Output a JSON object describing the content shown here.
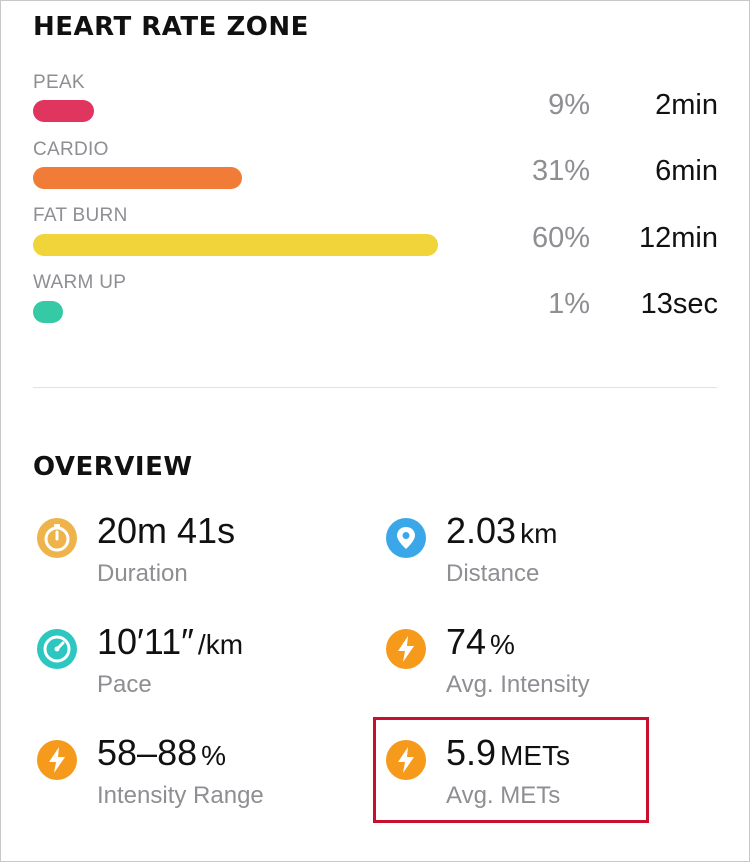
{
  "heart_rate_zone": {
    "title": "HEART RATE ZONE",
    "zones": [
      {
        "label": "PEAK",
        "percent": "9%",
        "time": "2min",
        "fraction": 0.09,
        "color": "#e0355f"
      },
      {
        "label": "CARDIO",
        "percent": "31%",
        "time": "6min",
        "fraction": 0.31,
        "color": "#f07c37"
      },
      {
        "label": "FAT BURN",
        "percent": "60%",
        "time": "12min",
        "fraction": 0.6,
        "color": "#f0d43a"
      },
      {
        "label": "WARM UP",
        "percent": "1%",
        "time": "13sec",
        "fraction": 0.01,
        "color": "#35c9a6"
      }
    ]
  },
  "overview": {
    "title": "OVERVIEW",
    "duration": {
      "value": "20m 41s",
      "unit": "",
      "label": "Duration",
      "icon": "timer-icon",
      "color": "#eeb34b"
    },
    "distance": {
      "value": "2.03",
      "unit": "km",
      "label": "Distance",
      "icon": "location-pin-icon",
      "color": "#3aa8e8"
    },
    "pace": {
      "value": "10′11″",
      "unit": "/km",
      "label": "Pace",
      "icon": "speedometer-icon",
      "color": "#2cc7c1"
    },
    "avg_intensity": {
      "value": "74",
      "unit": "%",
      "label": "Avg. Intensity",
      "icon": "lightning-icon",
      "color": "#f59a1b"
    },
    "intensity_range": {
      "value": "58–88",
      "unit": "%",
      "label": "Intensity Range",
      "icon": "lightning-icon",
      "color": "#f59a1b"
    },
    "avg_mets": {
      "value": "5.9",
      "unit": "METs",
      "label": "Avg. METs",
      "icon": "lightning-icon",
      "color": "#f59a1b"
    }
  },
  "highlight_color": "#c8102e"
}
